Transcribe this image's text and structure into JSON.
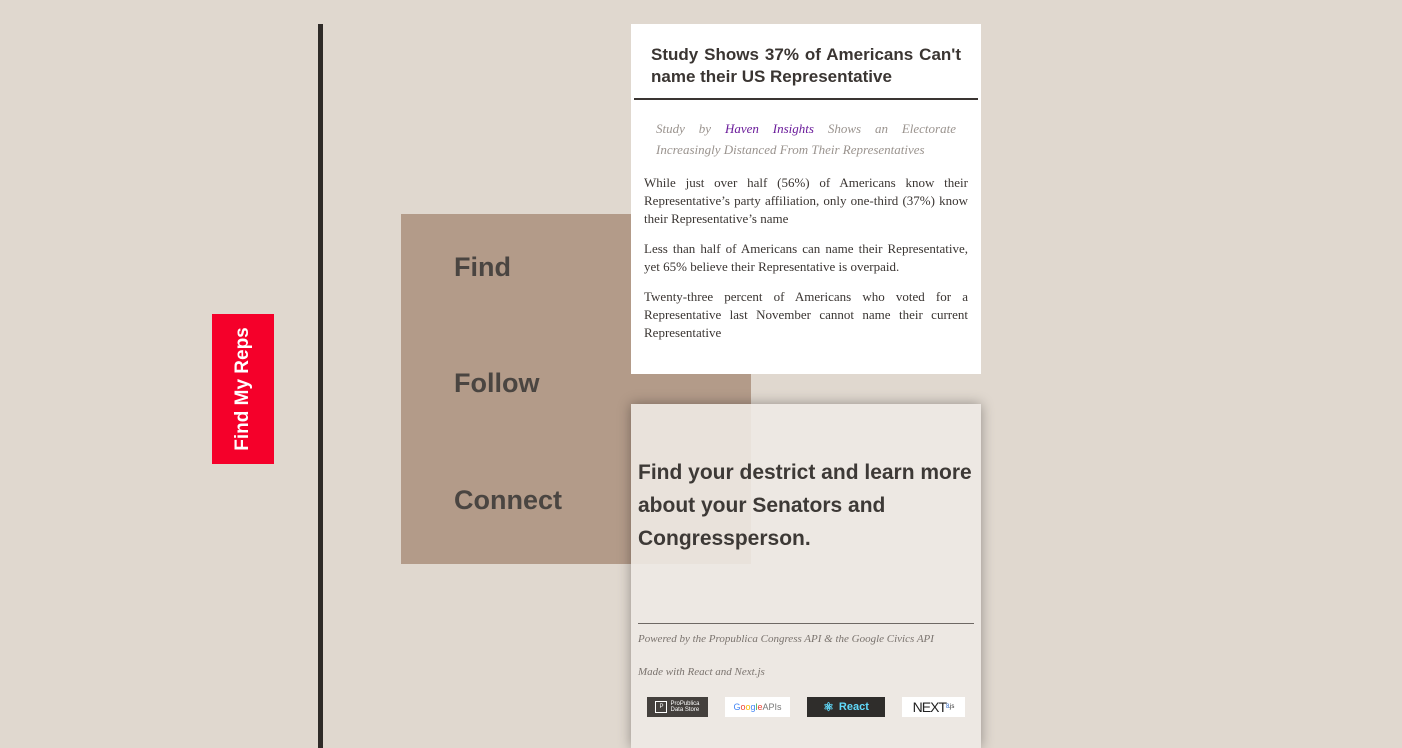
{
  "sidebar": {
    "find_button_label": "Find My Reps"
  },
  "menu": {
    "items": [
      "Find",
      "Follow",
      "Connect"
    ]
  },
  "article": {
    "title": "Study Shows 37% of Americans Can't name their US Representative",
    "subtitle_prefix": "Study by",
    "subtitle_brand": "Haven Insights",
    "subtitle_suffix": "Shows an Electorate Increasingly Distanced From Their Representatives",
    "paragraphs": [
      "While just over half (56%) of Americans know their Representative’s party affiliation, only one-third (37%) know their Representative’s name",
      "Less than half of Americans can name their Representative, yet 65% believe their Representative is overpaid.",
      "Twenty-three percent of Americans who voted for a Representative last November cannot name their current Representative"
    ]
  },
  "info_card": {
    "heading": "Find your destrict and learn more about your Senators and Congressperson.",
    "powered_by": "Powered by the Propublica Congress API & the Google Civics API",
    "made_with": "Made with React and Next.js",
    "badges": {
      "propublica_line1": "ProPublica",
      "propublica_line2": "Data Store",
      "google_apis": "APIs",
      "react": "React",
      "next": "NEXT",
      "next_version": "8",
      "next_suffix": ".js"
    }
  },
  "colors": {
    "background": "#e0d8cf",
    "accent_red": "#f5002a",
    "panel_brown": "#b39b89",
    "link_purple": "#6a1b9a"
  }
}
